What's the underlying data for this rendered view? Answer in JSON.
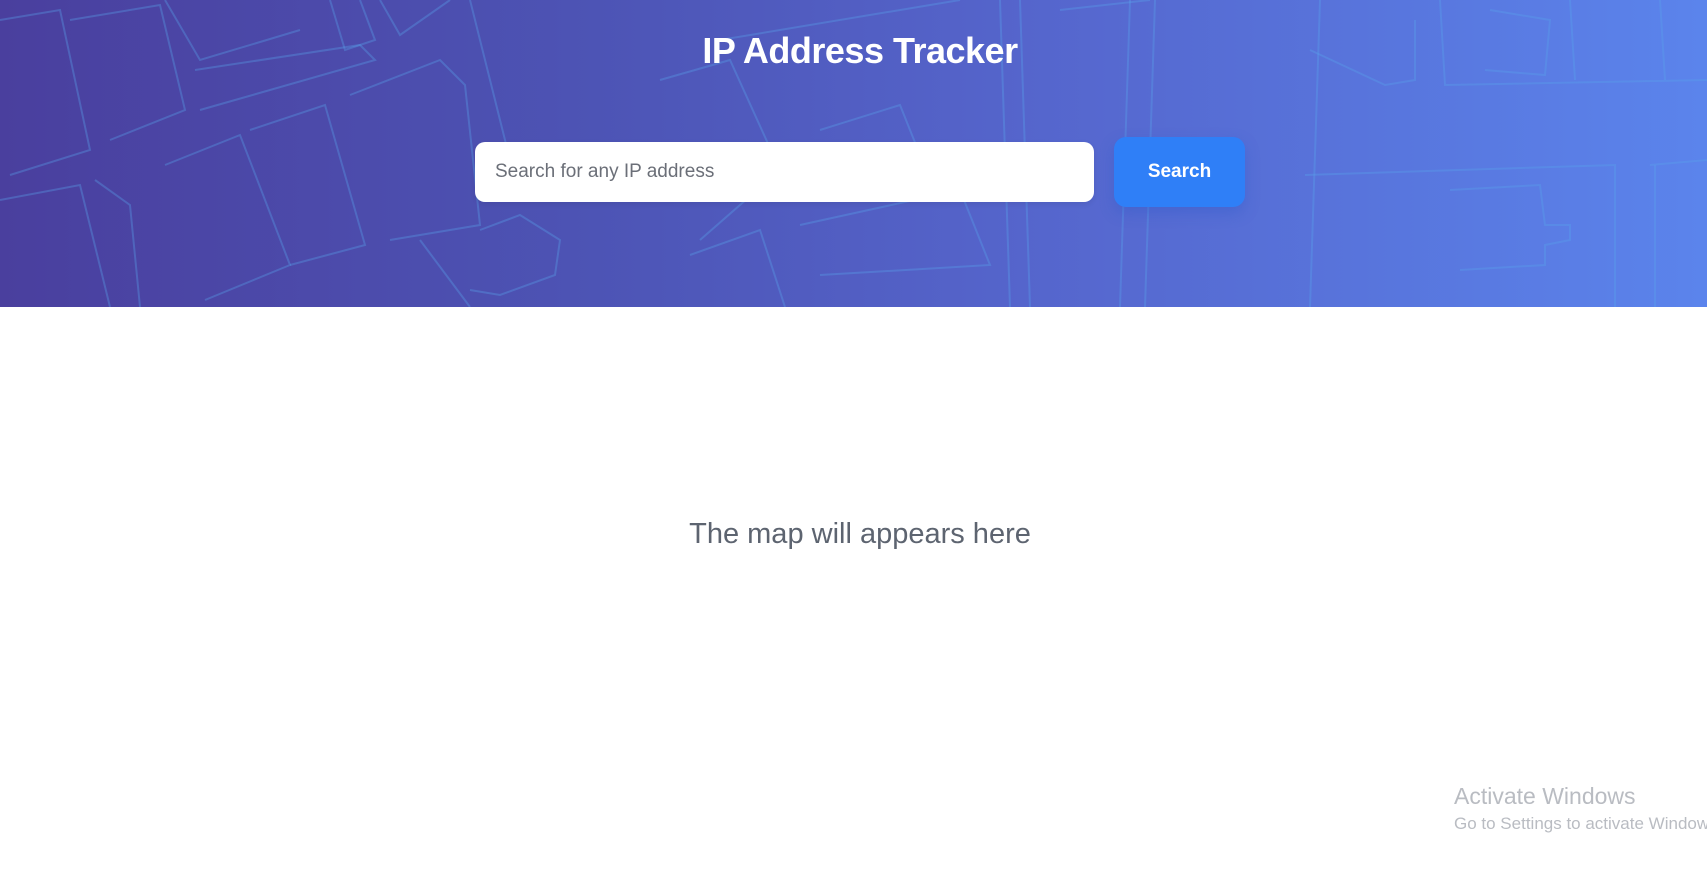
{
  "header": {
    "title": "IP Address Tracker",
    "gradient_colors": [
      "#4a3f9e",
      "#5565cc",
      "#5b84ec"
    ]
  },
  "search": {
    "placeholder": "Search for any IP address",
    "value": "",
    "button_label": "Search",
    "button_color": "#2f7ff7"
  },
  "map": {
    "placeholder_text": "The map will appears here"
  },
  "watermark": {
    "title": "Activate Windows",
    "subtitle": "Go to Settings to activate Windows."
  }
}
